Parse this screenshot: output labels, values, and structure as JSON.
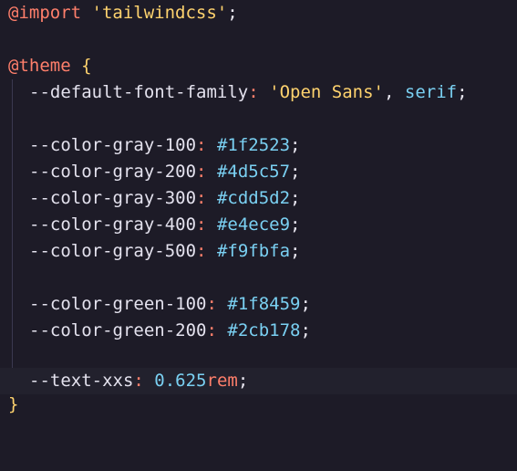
{
  "editor": {
    "colors": {
      "background": "#1d1b27",
      "at_rule": "#ff7f6b",
      "string": "#ffd36e",
      "property": "#e4e2ee",
      "value": "#7ad0f2"
    },
    "lines": {
      "l1": {
        "at": "@import",
        "sp": " ",
        "str": "'tailwindcss'",
        "end": ";"
      },
      "l3": {
        "at": "@theme",
        "sp": " ",
        "brace": "{"
      },
      "l4": {
        "prop": "--default-font-family",
        "colon": ":",
        "sp": " ",
        "str": "'Open Sans'",
        "comma": ",",
        "sp2": " ",
        "val": "serif",
        "end": ";"
      },
      "l6": {
        "prop": "--color-gray-100",
        "colon": ":",
        "sp": " ",
        "val": "#1f2523",
        "end": ";"
      },
      "l7": {
        "prop": "--color-gray-200",
        "colon": ":",
        "sp": " ",
        "val": "#4d5c57",
        "end": ";"
      },
      "l8": {
        "prop": "--color-gray-300",
        "colon": ":",
        "sp": " ",
        "val": "#cdd5d2",
        "end": ";"
      },
      "l9": {
        "prop": "--color-gray-400",
        "colon": ":",
        "sp": " ",
        "val": "#e4ece9",
        "end": ";"
      },
      "l10": {
        "prop": "--color-gray-500",
        "colon": ":",
        "sp": " ",
        "val": "#f9fbfa",
        "end": ";"
      },
      "l12": {
        "prop": "--color-green-100",
        "colon": ":",
        "sp": " ",
        "val": "#1f8459",
        "end": ";"
      },
      "l13": {
        "prop": "--color-green-200",
        "colon": ":",
        "sp": " ",
        "val": "#2cb178",
        "end": ";"
      },
      "l15": {
        "prop": "--text-xxs",
        "colon": ":",
        "sp": " ",
        "num": "0.625",
        "unit": "rem",
        "end": ";"
      },
      "l16": {
        "brace": "}"
      }
    }
  }
}
